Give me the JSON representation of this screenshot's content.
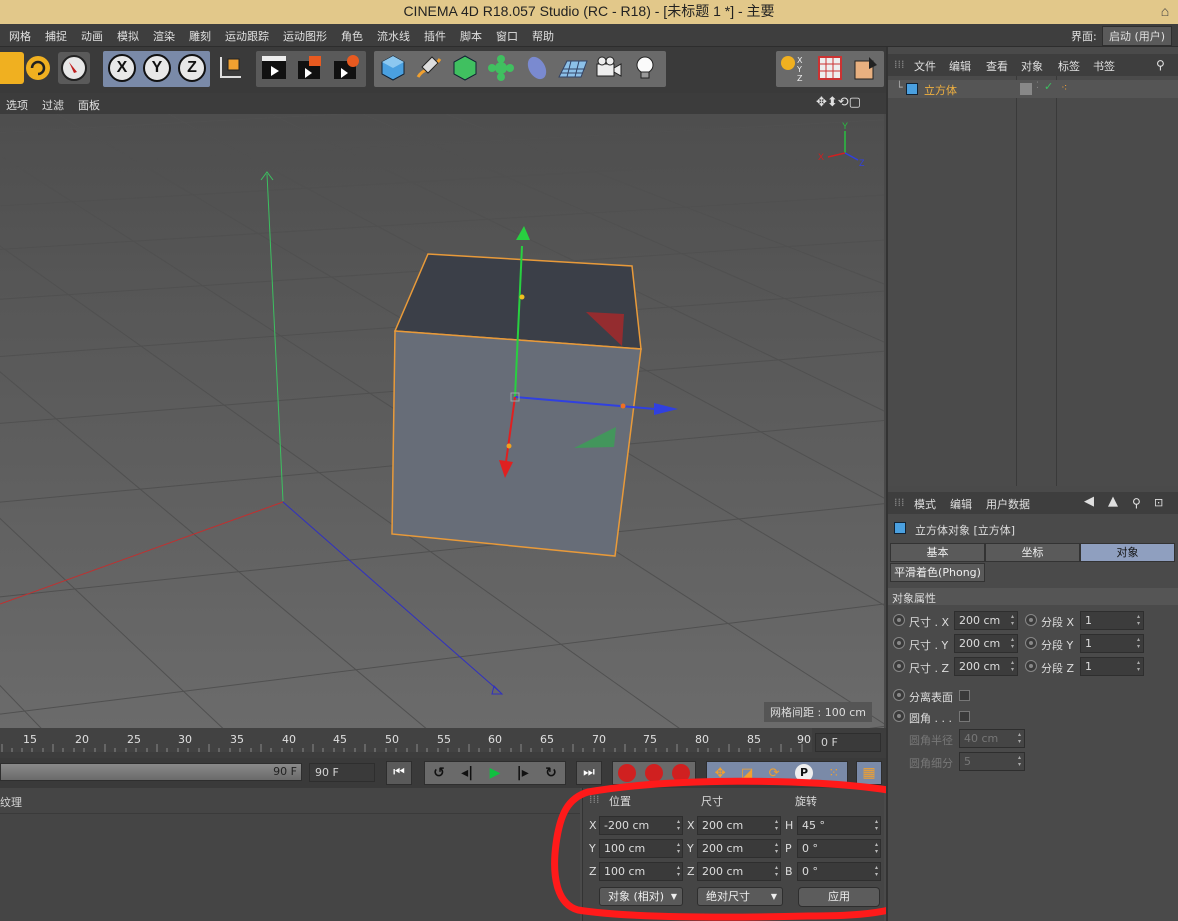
{
  "window": {
    "title": "CINEMA 4D R18.057 Studio (RC - R18) - [未标题 1 *] - 主要"
  },
  "menubar": {
    "items": [
      "网格",
      "捕捉",
      "动画",
      "模拟",
      "渲染",
      "雕刻",
      "运动跟踪",
      "运动图形",
      "角色",
      "流水线",
      "插件",
      "脚本",
      "窗口",
      "帮助"
    ],
    "layout_label": "界面:",
    "layout_value": "启动 (用户)"
  },
  "toolbar": {
    "axis_x": "X",
    "axis_y": "Y",
    "axis_z": "Z"
  },
  "viewport_menu": {
    "items": [
      "选项",
      "过滤",
      "面板"
    ]
  },
  "viewport": {
    "grid_spacing_label": "网格间距 : 100 cm",
    "axis_gizmo": {
      "x": "X",
      "y": "Y",
      "z": "Z"
    }
  },
  "timeline": {
    "ticks": [
      "15",
      "20",
      "25",
      "30",
      "35",
      "40",
      "45",
      "50",
      "55",
      "60",
      "65",
      "70",
      "75",
      "80",
      "85",
      "90"
    ],
    "current_frame": "0 F",
    "end_frame_slider": "90 F",
    "end_frame_field": "90 F"
  },
  "material_panel": {
    "label": "纹理"
  },
  "coord_panel": {
    "headers": {
      "position": "位置",
      "size": "尺寸",
      "rotation": "旋转"
    },
    "rows": [
      {
        "pos_axis": "X",
        "pos": "-200 cm",
        "size_axis": "X",
        "size": "200 cm",
        "rot_axis": "H",
        "rot": "45 °"
      },
      {
        "pos_axis": "Y",
        "pos": "100 cm",
        "size_axis": "Y",
        "size": "200 cm",
        "rot_axis": "P",
        "rot": "0 °"
      },
      {
        "pos_axis": "Z",
        "pos": "100 cm",
        "size_axis": "Z",
        "size": "200 cm",
        "rot_axis": "B",
        "rot": "0 °"
      }
    ],
    "mode_dropdown": "对象 (相对)",
    "size_dropdown": "绝对尺寸",
    "apply_button": "应用"
  },
  "object_manager": {
    "menu": [
      "文件",
      "编辑",
      "查看",
      "对象",
      "标签",
      "书签"
    ],
    "objects": [
      {
        "name": "立方体"
      }
    ]
  },
  "attribute_manager": {
    "menu": [
      "模式",
      "编辑",
      "用户数据"
    ],
    "object_title": "立方体对象 [立方体]",
    "tabs": [
      "基本",
      "坐标",
      "对象"
    ],
    "active_tab": "对象",
    "phong_tab": "平滑着色(Phong)",
    "section_title": "对象属性",
    "size_rows": [
      {
        "label": "尺寸 . X",
        "value": "200 cm",
        "seg_label": "分段 X",
        "seg_value": "1"
      },
      {
        "label": "尺寸 . Y",
        "value": "200 cm",
        "seg_label": "分段 Y",
        "seg_value": "1"
      },
      {
        "label": "尺寸 . Z",
        "value": "200 cm",
        "seg_label": "分段 Z",
        "seg_value": "1"
      }
    ],
    "separate_surfaces": "分离表面",
    "fillet": "圆角 . . .",
    "fillet_radius_label": "圆角半径",
    "fillet_radius_value": "40 cm",
    "fillet_subdiv_label": "圆角细分",
    "fillet_subdiv_value": "5"
  },
  "colors": {
    "title_bar": "#e2c88a",
    "selection_orange": "#e89a3a",
    "active_tab": "#8f9fbf",
    "annotation_red": "#ff1a1a"
  }
}
